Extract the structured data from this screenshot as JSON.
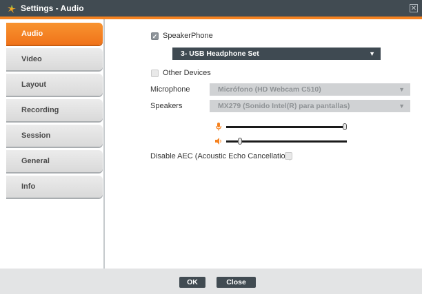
{
  "window": {
    "title": "Settings - Audio",
    "close_label": "✕"
  },
  "sidebar": {
    "items": [
      {
        "label": "Audio"
      },
      {
        "label": "Video"
      },
      {
        "label": "Layout"
      },
      {
        "label": "Recording"
      },
      {
        "label": "Session"
      },
      {
        "label": "General"
      },
      {
        "label": "Info"
      }
    ]
  },
  "audio": {
    "speakerphone_label": "SpeakerPhone",
    "speakerphone_checked": true,
    "speakerphone_device": "3- USB Headphone Set",
    "other_devices_label": "Other Devices",
    "other_devices_checked": false,
    "microphone_label": "Microphone",
    "microphone_value": "Micrófono (HD Webcam C510)",
    "speakers_label": "Speakers",
    "speakers_value": "MX279 (Sonido Intel(R) para pantallas)",
    "mic_level": 1.0,
    "speaker_level": 0.1,
    "aec_label": "Disable AEC (Acoustic Echo Cancellation)",
    "aec_checked": false
  },
  "footer": {
    "ok_label": "OK",
    "close_label": "Close"
  },
  "colors": {
    "accent": "#f58220",
    "dark": "#414b52"
  }
}
